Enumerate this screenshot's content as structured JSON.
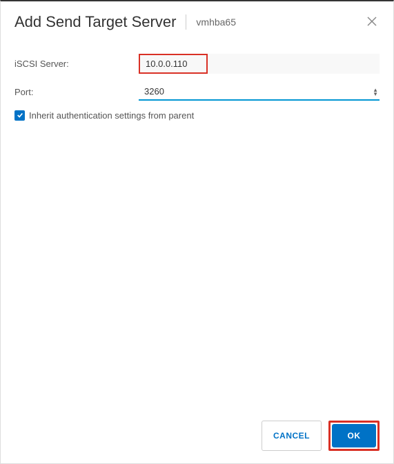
{
  "header": {
    "title": "Add Send Target Server",
    "adapter": "vmhba65"
  },
  "form": {
    "server_label": "iSCSI Server:",
    "server_value": "10.0.0.110",
    "port_label": "Port:",
    "port_value": "3260",
    "inherit_label": "Inherit authentication settings from parent"
  },
  "footer": {
    "cancel": "CANCEL",
    "ok": "OK"
  }
}
